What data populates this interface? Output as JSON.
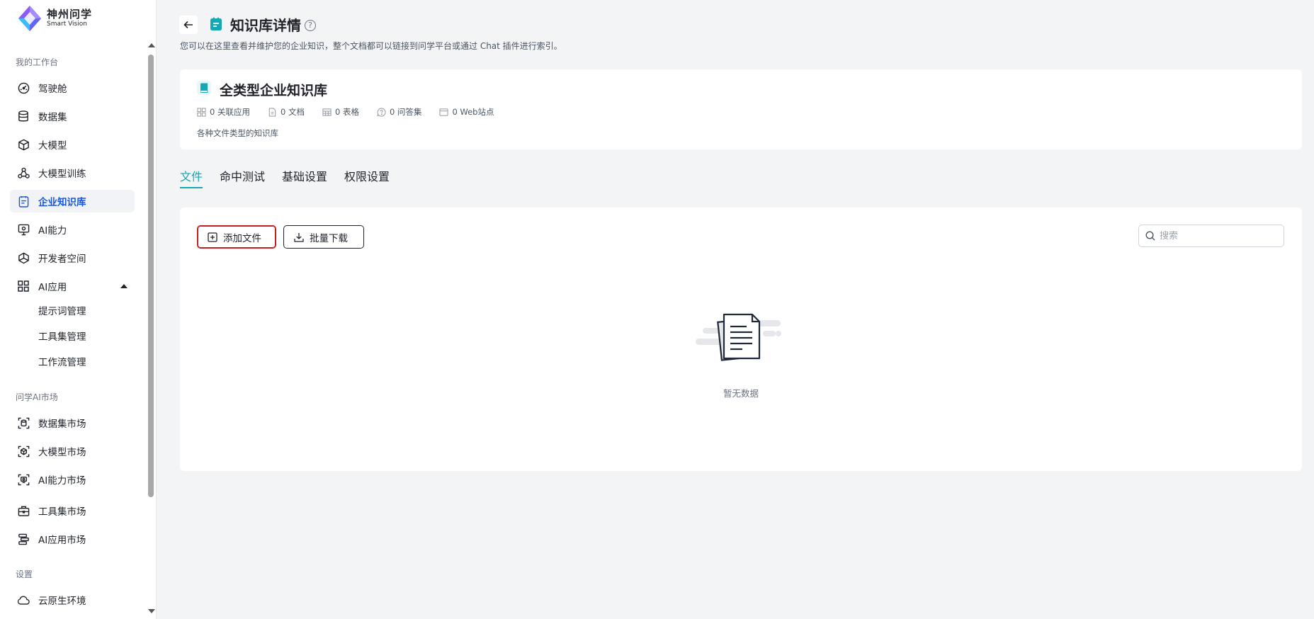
{
  "brand": {
    "name_cn": "神州问学",
    "name_en": "Smart Vision"
  },
  "sidebar": {
    "sections": [
      "我的工作台",
      "问学AI市场",
      "设置"
    ],
    "items": [
      {
        "label": "驾驶舱",
        "icon": "dashboard-icon"
      },
      {
        "label": "数据集",
        "icon": "database-icon"
      },
      {
        "label": "大模型",
        "icon": "cube-icon"
      },
      {
        "label": "大模型训练",
        "icon": "training-icon"
      },
      {
        "label": "企业知识库",
        "icon": "knowledge-icon",
        "active": true
      },
      {
        "label": "AI能力",
        "icon": "monitor-icon"
      },
      {
        "label": "开发者空间",
        "icon": "dev-space-icon"
      },
      {
        "label": "AI应用",
        "icon": "apps-grid-icon",
        "expanded": true
      }
    ],
    "sub_items": [
      "提示词管理",
      "工具集管理",
      "工作流管理"
    ],
    "market_items": [
      {
        "label": "数据集市场",
        "icon": "dataset-market-icon"
      },
      {
        "label": "大模型市场",
        "icon": "model-market-icon"
      },
      {
        "label": "AI能力市场",
        "icon": "ai-market-icon"
      },
      {
        "label": "工具集市场",
        "icon": "toolbox-icon"
      },
      {
        "label": "AI应用市场",
        "icon": "app-market-icon"
      }
    ],
    "settings_items": [
      {
        "label": "云原生环境",
        "icon": "cloud-icon"
      }
    ]
  },
  "header": {
    "title": "知识库详情",
    "description": "您可以在这里查看并维护您的企业知识，整个文档都可以链接到问学平台或通过 Chat 插件进行索引。"
  },
  "kb": {
    "name": "全类型企业知识库",
    "stats": [
      {
        "label": "0 关联应用",
        "icon": "linked-apps-icon"
      },
      {
        "label": "0 文档",
        "icon": "document-icon"
      },
      {
        "label": "0 表格",
        "icon": "table-icon"
      },
      {
        "label": "0 问答集",
        "icon": "qa-icon"
      },
      {
        "label": "0 Web站点",
        "icon": "web-site-icon"
      }
    ],
    "description": "各种文件类型的知识库"
  },
  "tabs": [
    "文件",
    "命中测试",
    "基础设置",
    "权限设置"
  ],
  "toolbar": {
    "add_label": "添加文件",
    "download_label": "批量下载",
    "search_placeholder": "搜索"
  },
  "empty": {
    "text": "暂无数据"
  },
  "colors": {
    "accent": "#14a8b4",
    "active_nav": "#1a56db",
    "highlight_border": "#c21f1f"
  }
}
